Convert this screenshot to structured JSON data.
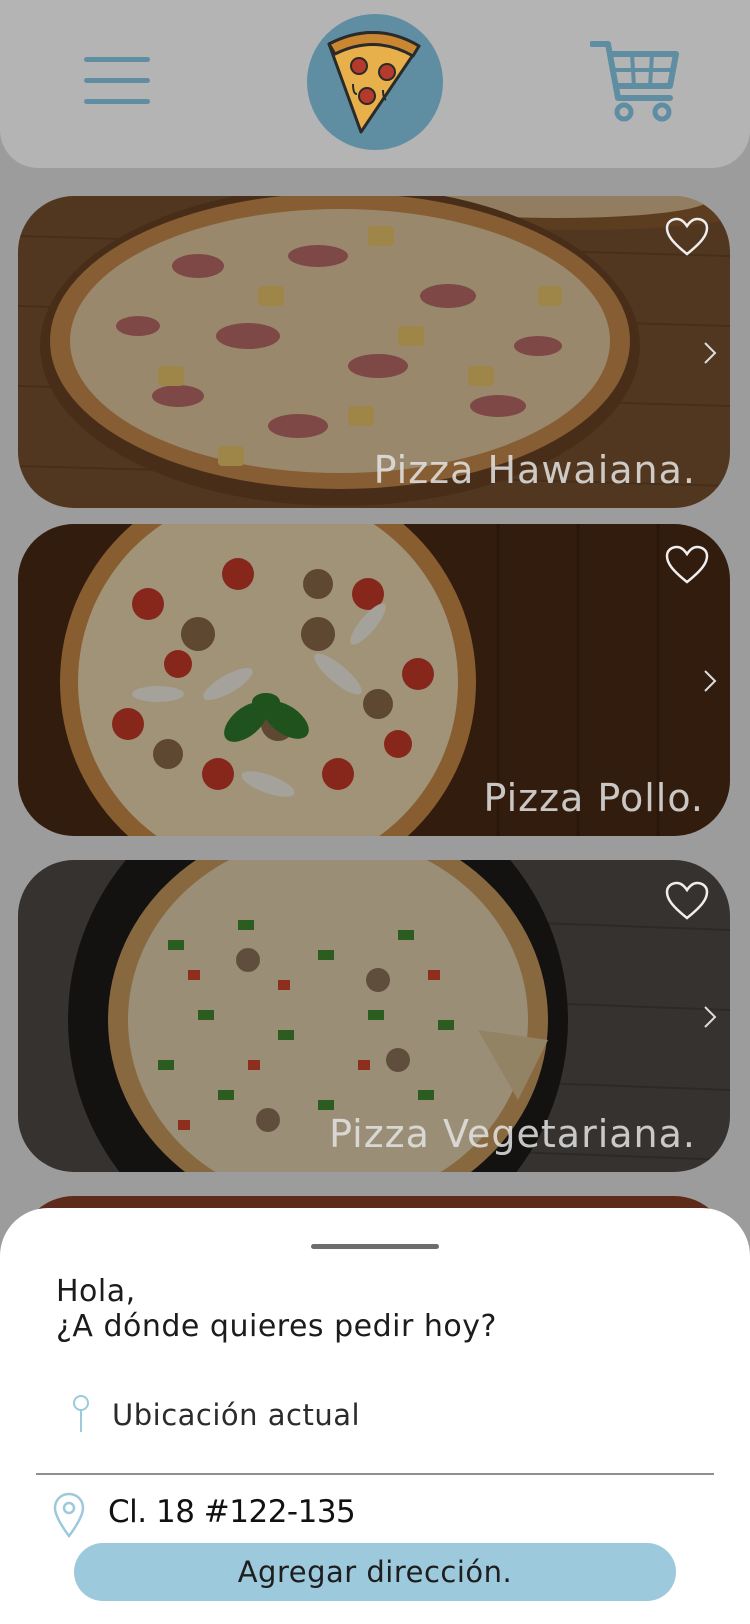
{
  "header": {
    "menu_icon": "hamburger-menu-icon",
    "logo_icon": "pizza-slice-logo",
    "cart_icon": "shopping-cart-icon",
    "accent_color": "#5f8ea3"
  },
  "pizzas": [
    {
      "title": "Pizza Hawaiana.",
      "favorite_icon": "heart-outline-icon",
      "arrow_icon": "chevron-right-icon"
    },
    {
      "title": "Pizza Pollo.",
      "favorite_icon": "heart-outline-icon",
      "arrow_icon": "chevron-right-icon"
    },
    {
      "title": "Pizza Vegetariana.",
      "favorite_icon": "heart-outline-icon",
      "arrow_icon": "chevron-right-icon"
    }
  ],
  "sheet": {
    "greeting_line1": "Hola,",
    "greeting_line2": "¿A dónde quieres pedir hoy?",
    "current_location_label": "Ubicación actual",
    "saved_address": "Cl. 18 #122-135",
    "add_address_button": "Agregar dirección.",
    "button_color": "#9cc9dc"
  }
}
